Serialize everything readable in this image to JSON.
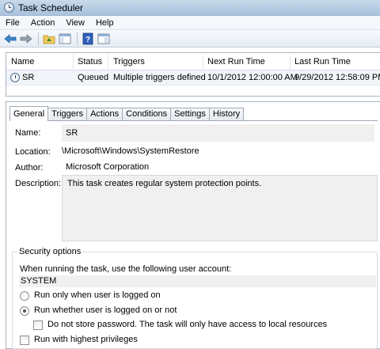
{
  "window": {
    "title": "Task Scheduler"
  },
  "menu": [
    "File",
    "Action",
    "View",
    "Help"
  ],
  "toolbar": {
    "icons": [
      "back-arrow-icon",
      "forward-arrow-icon",
      "folder-up-icon",
      "show-hide-tree-icon",
      "help-icon",
      "properties-icon"
    ]
  },
  "task_list": {
    "columns": [
      "Name",
      "Status",
      "Triggers",
      "Next Run Time",
      "Last Run Time"
    ],
    "rows": [
      {
        "name": "SR",
        "status": "Queued",
        "triggers": "Multiple triggers defined",
        "next_run": "10/1/2012 12:00:00 AM",
        "last_run": "9/29/2012 12:58:09 PM"
      }
    ]
  },
  "tabs": [
    "General",
    "Triggers",
    "Actions",
    "Conditions",
    "Settings",
    "History"
  ],
  "general": {
    "name_label": "Name:",
    "name_value": "SR",
    "location_label": "Location:",
    "location_value": "\\Microsoft\\Windows\\SystemRestore",
    "author_label": "Author:",
    "author_value": "Microsoft Corporation",
    "description_label": "Description:",
    "description_value": "This task creates regular system protection points."
  },
  "security": {
    "title": "Security options",
    "account_prompt": "When running the task, use the following user account:",
    "account": "SYSTEM",
    "radio_logged_on": "Run only when user is logged on",
    "radio_whether": "Run whether user is logged on or not",
    "selected": "Run whether user is logged on or not",
    "no_store_password": "Do not store password.  The task will only have access to local resources",
    "highest_privileges": "Run with highest privileges"
  }
}
